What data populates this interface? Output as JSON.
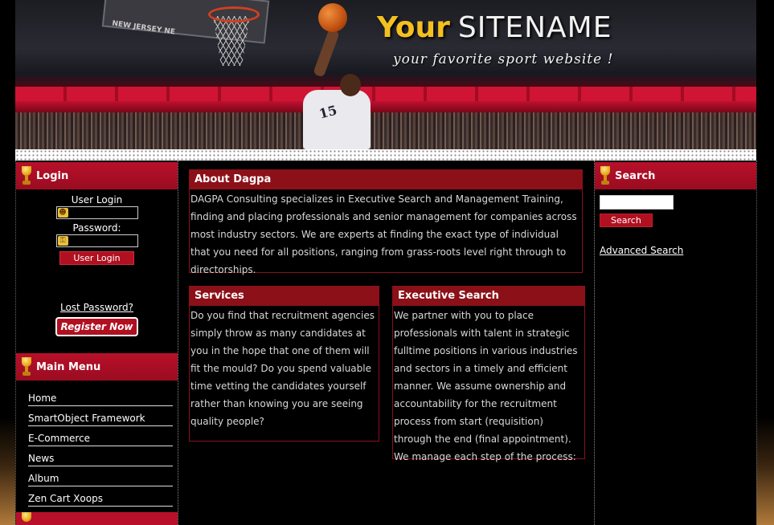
{
  "header": {
    "title_your": "Your",
    "title_sitename": "SITENAME",
    "slogan": "your favorite sport website !",
    "backboard_text": "NEW JERSEY NE",
    "jersey_number": "15"
  },
  "login": {
    "title": "Login",
    "user_label": "User Login",
    "password_label": "Password:",
    "submit_label": "User Login",
    "lost_password": "Lost Password?",
    "register": "Register Now"
  },
  "main_menu": {
    "title": "Main Menu",
    "items": [
      "Home",
      "SmartObject Framework",
      "E-Commerce",
      "News",
      "Album",
      "Zen Cart Xoops"
    ]
  },
  "about": {
    "title": "About Dagpa",
    "text": "DAGPA Consulting specializes in Executive Search and Management Training, finding and placing professionals and senior management for companies across most industry sectors. We are experts at finding the exact type of individual that you need for all positions, ranging from grass-roots level right through to directorships."
  },
  "services": {
    "title": "Services",
    "text": "Do you find that recruitment agencies simply throw as many candidates at you in the hope that one of them will fit the mould? Do you spend valuable time vetting the candidates yourself rather than knowing you are seeing quality people?"
  },
  "executive": {
    "title": "Executive Search",
    "text": "We partner with you to place professionals with talent in strategic fulltime positions in various industries and sectors in a timely and efficient manner. We assume ownership and accountability for the recruitment process from start (requisition) through the end (final appointment). We manage each step of the process:"
  },
  "search": {
    "title": "Search",
    "button": "Search",
    "advanced": "Advanced Search"
  },
  "colors": {
    "block_red": "#b8102a",
    "box_border": "#8a1020",
    "title_gold": "#f3c020"
  }
}
